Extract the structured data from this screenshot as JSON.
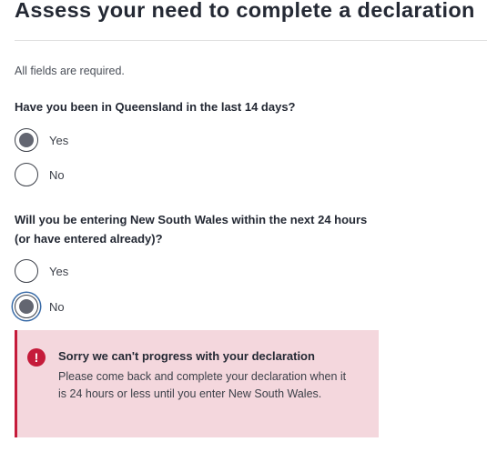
{
  "page": {
    "title": "Assess your need to complete a declaration",
    "required_note": "All fields are required."
  },
  "questions": [
    {
      "text": "Have you been in Queensland in the last 14 days?",
      "options": [
        {
          "label": "Yes",
          "checked": true
        },
        {
          "label": "No",
          "checked": false
        }
      ]
    },
    {
      "text": "Will you be entering New South Wales within the next 24 hours (or have entered already)?",
      "options": [
        {
          "label": "Yes",
          "checked": false
        },
        {
          "label": "No",
          "checked": true
        }
      ]
    }
  ],
  "error": {
    "icon": "exclamation-icon",
    "icon_glyph": "!",
    "title": "Sorry we can't progress with your declaration",
    "body": "Please come back and complete your declaration when it is 24 hours or less until you enter New South Wales.",
    "accent_color": "#c51b3a",
    "background_color": "#f4d7dd"
  }
}
